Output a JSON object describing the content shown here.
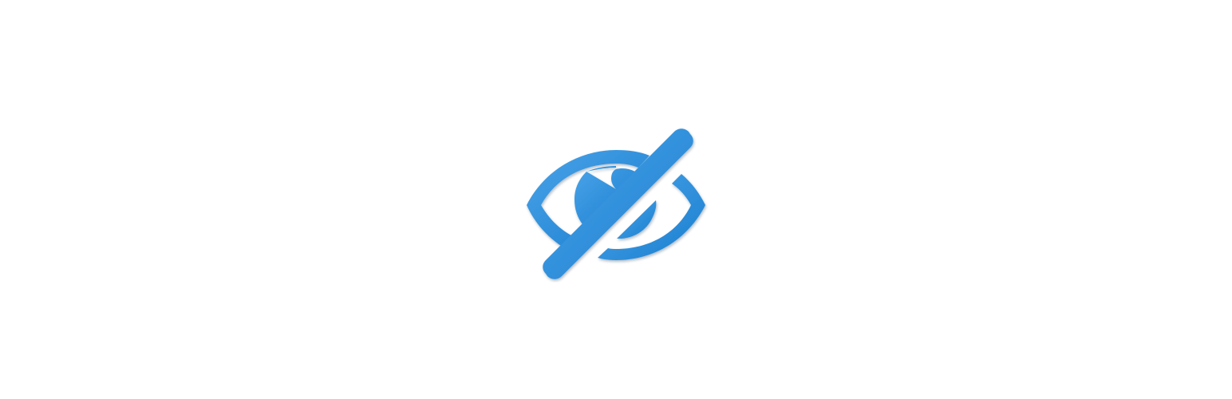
{
  "icon": {
    "semantic": "eye-off-icon",
    "colors": {
      "gradient_start": "#4aa3e8",
      "gradient_end": "#1a7fd0",
      "background": "#ffffff",
      "shadow": "#1a3a5a"
    }
  }
}
